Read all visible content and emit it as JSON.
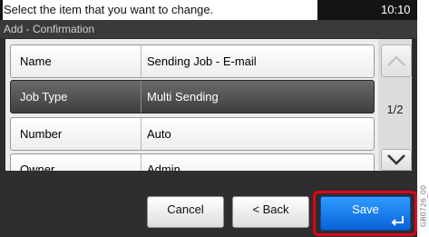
{
  "header": {
    "message": "Select the item that you want to change.",
    "time": "10:10"
  },
  "title": "Add - Confirmation",
  "rows": [
    {
      "label": "Name",
      "value": "Sending Job - E-mail",
      "selected": false
    },
    {
      "label": "Job Type",
      "value": "Multi Sending",
      "selected": true
    },
    {
      "label": "Number",
      "value": "Auto",
      "selected": false
    },
    {
      "label": "Owner",
      "value": "Admin",
      "selected": false
    }
  ],
  "pagination": {
    "indicator": "1/2",
    "up_icon": "chevron-up-icon",
    "down_icon": "chevron-down-icon"
  },
  "buttons": {
    "cancel": "Cancel",
    "back": "< Back",
    "save": "Save",
    "save_icon": "enter-icon"
  },
  "image_code": "GB0726_00",
  "colors": {
    "save_button": "#1a7ef0",
    "highlight": "#e1001c",
    "selected_row": "#4f4f4f"
  }
}
